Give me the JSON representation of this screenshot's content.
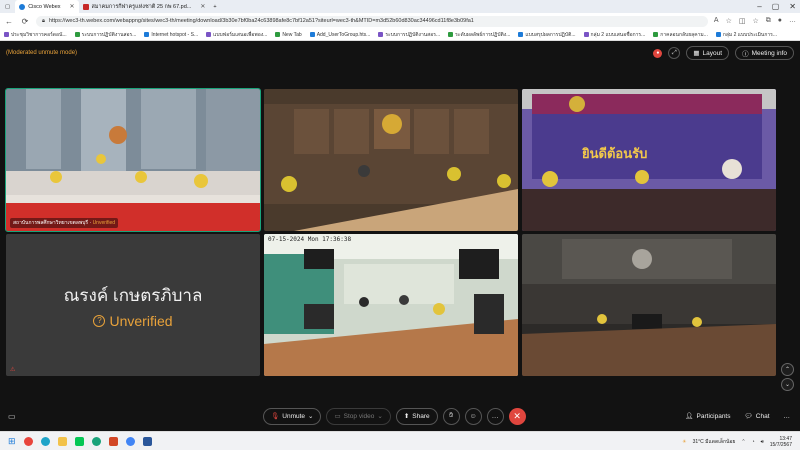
{
  "browser": {
    "tabs": [
      {
        "label": "Cisco Webex",
        "active": true
      },
      {
        "label": "สมาคมการกีฬาครูแห่งชาติ 25 กพ 67.pd...",
        "active": false
      }
    ],
    "url": "https://wec3-th.webex.com/webappng/sites/wec3-th/meeting/download/3b30e7bf0ba24c63898afe8c7bf12a51?siteurl=wec3-th&MTID=m3d52b60d830ac34496cd11f8e3b09fa1",
    "bookmarks": [
      "ประชุมวิชาการคอร์ดอนั...",
      "ระบบการปฏิบัติงานสอร...",
      "Internet hotspot - S...",
      "แบบฟอร์มเสนอเพื่อพอง...",
      "New Tab",
      "Add_UserToGroup.hts...",
      "ระบบการปฏิบัติงานสอร...",
      "ระดับผลลัพธ์การปฏิบัติง...",
      "แบบสรุปผลการปฏิบัติ...",
      "กลุ่ม 2 แบบเสนอชื่อการ...",
      "กาคลอนกลับยลุคาม...",
      "กลุ่ม 2 แบบประเมินการ..."
    ]
  },
  "webex": {
    "mode_label": "(Moderated unmute mode)",
    "layout_label": "Layout",
    "meeting_info_label": "Meeting info",
    "tiles": [
      {
        "label": "สถาบันการพลศึกษาวิทยาเขตลพบุรี",
        "status": "Unverified"
      },
      {
        "label": ""
      },
      {
        "label": ""
      },
      {
        "name": "ณรงค์ เกษตรภิบาล",
        "status": "Unverified"
      },
      {
        "timestamp": "07-15-2024 Mon 17:36:38"
      },
      {
        "label": ""
      }
    ],
    "banner_text": "ยินดีต้อนรับ",
    "controls": {
      "unmute": "Unmute",
      "stop_video": "Stop video",
      "share": "Share",
      "participants": "Participants",
      "chat": "Chat"
    }
  },
  "taskbar": {
    "weather": "31°C มีแดดเล็กน้อย",
    "time": "13:47",
    "date": "15/7/2567"
  },
  "colors": {
    "accent_orange": "#e8a23a",
    "end_red": "#e0463e",
    "active_green": "#1aa37a"
  }
}
